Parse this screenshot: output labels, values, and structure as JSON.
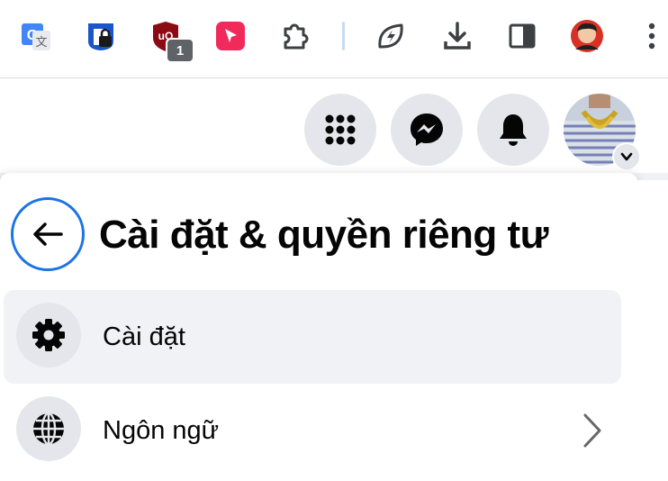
{
  "browser": {
    "extensions": [
      {
        "icon": "google-translate-icon"
      },
      {
        "icon": "password-lock-icon"
      },
      {
        "icon": "ublock-origin-icon",
        "badge": "1"
      },
      {
        "icon": "cursor-pointer-icon"
      },
      {
        "icon": "puzzle-extensions-icon"
      },
      {
        "icon": "leaf-bolt-icon"
      },
      {
        "icon": "download-icon"
      },
      {
        "icon": "side-panel-icon"
      },
      {
        "icon": "profile-avatar-icon"
      },
      {
        "icon": "more-menu-icon"
      }
    ]
  },
  "header": {
    "buttons": [
      "menu-grid-icon",
      "messenger-icon",
      "notifications-bell-icon",
      "account-avatar"
    ]
  },
  "panel": {
    "title": "Cài đặt & quyền riêng tư",
    "items": [
      {
        "label": "Cài đặt",
        "icon": "gear-icon",
        "active": true
      },
      {
        "label": "Ngôn ngữ",
        "icon": "globe-icon",
        "has_submenu": true
      }
    ]
  },
  "colors": {
    "accent": "#1b74e4",
    "arrow": "#f4511e",
    "hover": "#f0f2f5",
    "icon_bg": "#e4e6eb"
  }
}
